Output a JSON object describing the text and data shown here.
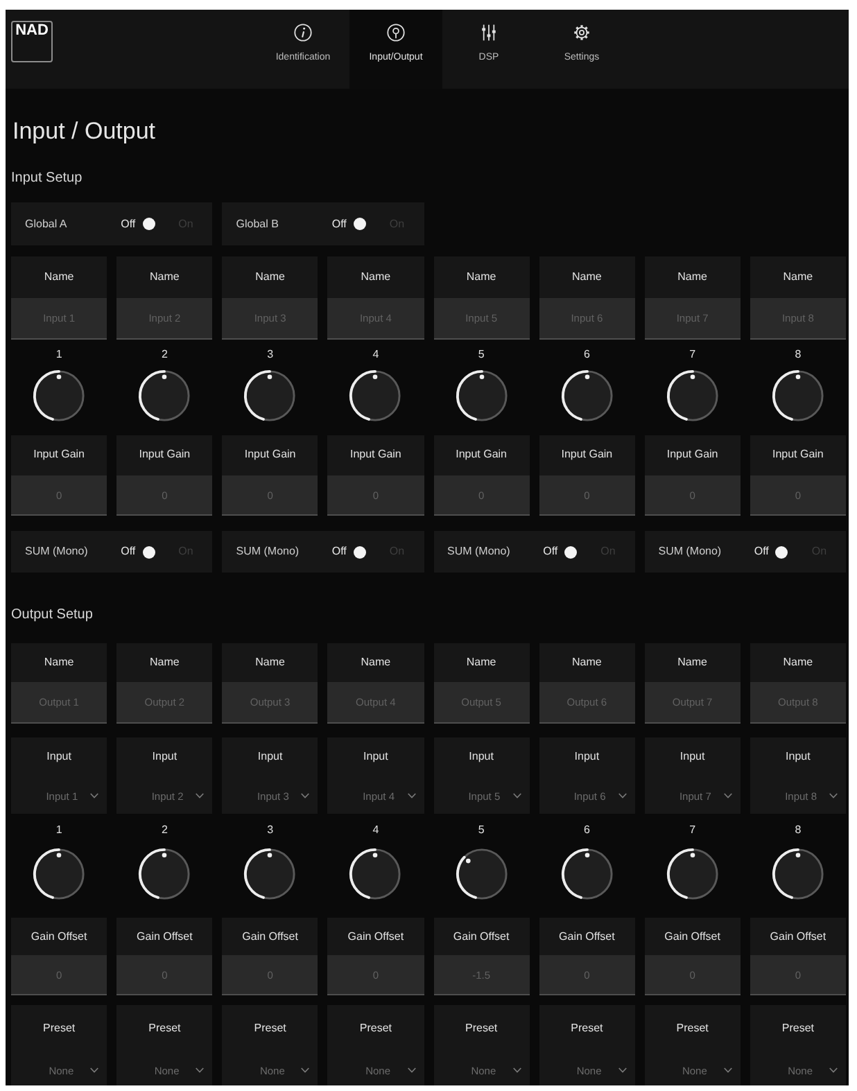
{
  "header": {
    "logo": "NAD",
    "tabs": [
      {
        "label": "Identification",
        "kind": "info",
        "selected": false
      },
      {
        "label": "Input/Output",
        "kind": "io",
        "selected": true
      },
      {
        "label": "DSP",
        "kind": "dsp",
        "selected": false
      },
      {
        "label": "Settings",
        "kind": "settings",
        "selected": false
      }
    ]
  },
  "page_title": "Input / Output",
  "input_setup": {
    "title": "Input Setup",
    "globals": [
      {
        "label": "Global A",
        "off_label": "Off",
        "on_label": "On",
        "on": false
      },
      {
        "label": "Global B",
        "off_label": "Off",
        "on_label": "On",
        "on": false
      }
    ],
    "channels": [
      {
        "name_label": "Name",
        "name_placeholder": "Input 1",
        "number": "1",
        "level": 0.5,
        "gain_label": "Input Gain",
        "gain_value": "0"
      },
      {
        "name_label": "Name",
        "name_placeholder": "Input 2",
        "number": "2",
        "level": 0.5,
        "gain_label": "Input Gain",
        "gain_value": "0"
      },
      {
        "name_label": "Name",
        "name_placeholder": "Input 3",
        "number": "3",
        "level": 0.5,
        "gain_label": "Input Gain",
        "gain_value": "0"
      },
      {
        "name_label": "Name",
        "name_placeholder": "Input 4",
        "number": "4",
        "level": 0.5,
        "gain_label": "Input Gain",
        "gain_value": "0"
      },
      {
        "name_label": "Name",
        "name_placeholder": "Input 5",
        "number": "5",
        "level": 0.5,
        "gain_label": "Input Gain",
        "gain_value": "0"
      },
      {
        "name_label": "Name",
        "name_placeholder": "Input 6",
        "number": "6",
        "level": 0.5,
        "gain_label": "Input Gain",
        "gain_value": "0"
      },
      {
        "name_label": "Name",
        "name_placeholder": "Input 7",
        "number": "7",
        "level": 0.5,
        "gain_label": "Input Gain",
        "gain_value": "0"
      },
      {
        "name_label": "Name",
        "name_placeholder": "Input 8",
        "number": "8",
        "level": 0.5,
        "gain_label": "Input Gain",
        "gain_value": "0"
      }
    ],
    "sums": [
      {
        "label": "SUM (Mono)",
        "off_label": "Off",
        "on_label": "On",
        "on": false
      },
      {
        "label": "SUM (Mono)",
        "off_label": "Off",
        "on_label": "On",
        "on": false
      },
      {
        "label": "SUM (Mono)",
        "off_label": "Off",
        "on_label": "On",
        "on": false
      },
      {
        "label": "SUM (Mono)",
        "off_label": "Off",
        "on_label": "On",
        "on": false
      }
    ]
  },
  "output_setup": {
    "title": "Output Setup",
    "channels": [
      {
        "name_label": "Name",
        "name_placeholder": "Output 1",
        "input_label": "Input",
        "input_value": "Input 1",
        "number": "1",
        "level": 0.5,
        "offset_label": "Gain Offset",
        "offset_value": "0",
        "preset_label": "Preset",
        "preset_value": "None"
      },
      {
        "name_label": "Name",
        "name_placeholder": "Output 2",
        "input_label": "Input",
        "input_value": "Input 2",
        "number": "2",
        "level": 0.5,
        "offset_label": "Gain Offset",
        "offset_value": "0",
        "preset_label": "Preset",
        "preset_value": "None"
      },
      {
        "name_label": "Name",
        "name_placeholder": "Output 3",
        "input_label": "Input",
        "input_value": "Input 3",
        "number": "3",
        "level": 0.5,
        "offset_label": "Gain Offset",
        "offset_value": "0",
        "preset_label": "Preset",
        "preset_value": "None"
      },
      {
        "name_label": "Name",
        "name_placeholder": "Output 4",
        "input_label": "Input",
        "input_value": "Input 4",
        "number": "4",
        "level": 0.5,
        "offset_label": "Gain Offset",
        "offset_value": "0",
        "preset_label": "Preset",
        "preset_value": "None"
      },
      {
        "name_label": "Name",
        "name_placeholder": "Output 5",
        "input_label": "Input",
        "input_value": "Input 5",
        "number": "5",
        "level": 0.36,
        "offset_label": "Gain Offset",
        "offset_value": "-1.5",
        "preset_label": "Preset",
        "preset_value": "None"
      },
      {
        "name_label": "Name",
        "name_placeholder": "Output 6",
        "input_label": "Input",
        "input_value": "Input 6",
        "number": "6",
        "level": 0.5,
        "offset_label": "Gain Offset",
        "offset_value": "0",
        "preset_label": "Preset",
        "preset_value": "None"
      },
      {
        "name_label": "Name",
        "name_placeholder": "Output 7",
        "input_label": "Input",
        "input_value": "Input 7",
        "number": "7",
        "level": 0.5,
        "offset_label": "Gain Offset",
        "offset_value": "0",
        "preset_label": "Preset",
        "preset_value": "None"
      },
      {
        "name_label": "Name",
        "name_placeholder": "Output 8",
        "input_label": "Input",
        "input_value": "Input 8",
        "number": "8",
        "level": 0.5,
        "offset_label": "Gain Offset",
        "offset_value": "0",
        "preset_label": "Preset",
        "preset_value": "None"
      }
    ]
  }
}
